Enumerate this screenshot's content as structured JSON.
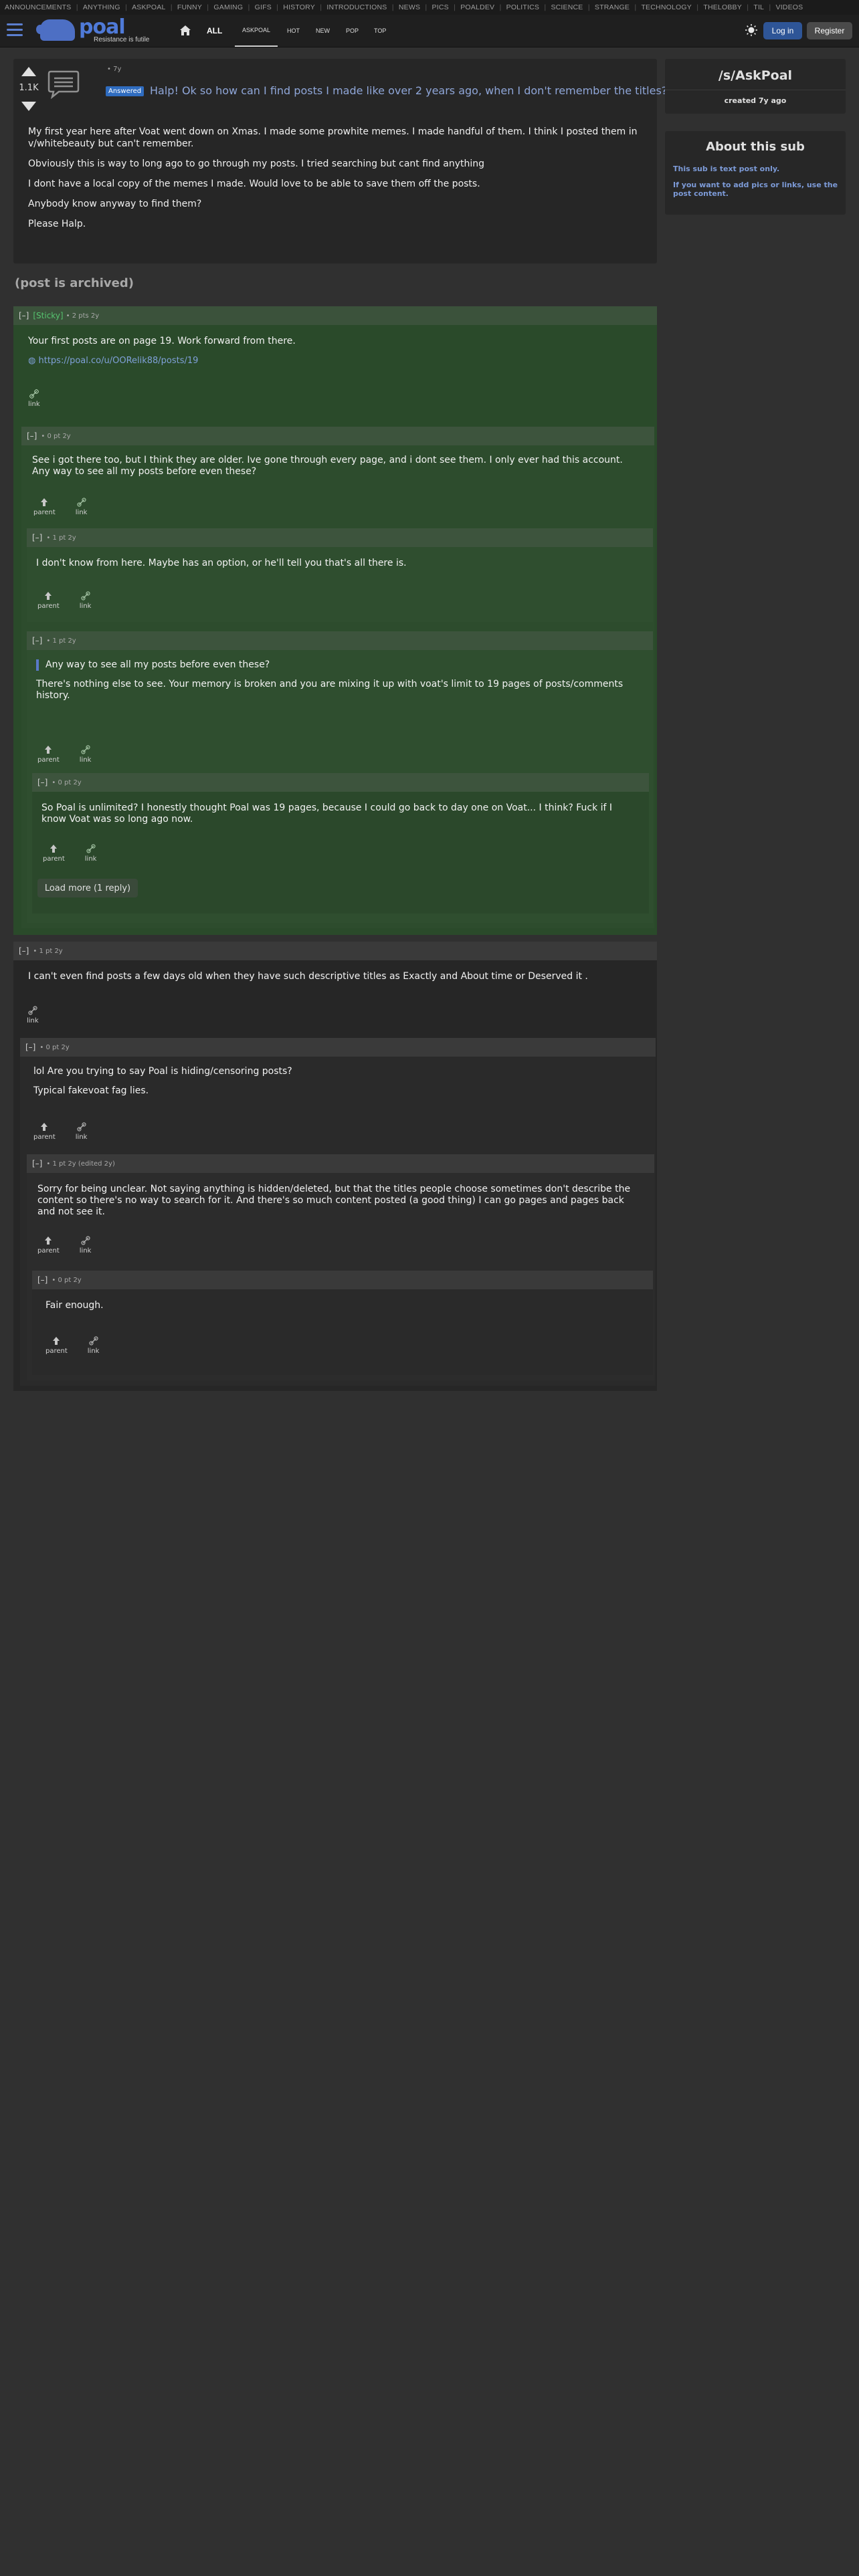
{
  "categories": [
    "ANNOUNCEMENTS",
    "ANYTHING",
    "ASKPOAL",
    "FUNNY",
    "GAMING",
    "GIFS",
    "HISTORY",
    "INTRODUCTIONS",
    "NEWS",
    "PICS",
    "POALDEV",
    "POLITICS",
    "SCIENCE",
    "STRANGE",
    "TECHNOLOGY",
    "THELOBBY",
    "TIL",
    "VIDEOS"
  ],
  "header": {
    "logo_text": "poal",
    "tagline": "Resistance is futile",
    "nav_all": "ALL",
    "nav_tabs": [
      "ASKPOAL",
      "HOT",
      "NEW",
      "POP",
      "TOP"
    ],
    "login": "Log in",
    "register": "Register"
  },
  "post": {
    "score": "1.1K",
    "meta": "• 7y",
    "flair": "Answered",
    "title": "Halp! Ok so how can I find posts I made like over 2 years ago, when I don't remember the titles?",
    "body": [
      "My first year here after Voat went down on Xmas. I made some prowhite memes. I made handful of them. I think I posted them in v/whitebeauty but can't remember.",
      "Obviously this is way to long ago to go through my posts. I tried searching but cant find anything",
      "I dont have a local copy of the memes I made. Would love to be able to save them off the posts.",
      "Anybody know anyway to find them?",
      "Please Halp."
    ],
    "archived": "(post is archived)"
  },
  "comments": {
    "c1": {
      "tog": "[–]",
      "sticky": "[Sticky]",
      "meta": "• 2 pts 2y",
      "text": "Your first posts are on page 19. Work forward from there.",
      "link": "https://poal.co/u/OORelik88/posts/19",
      "act": "link"
    },
    "c2": {
      "tog": "[–]",
      "meta": "• 0 pt 2y",
      "text": "See i got there too, but I think they are older. Ive gone through every page, and i dont see them. I only ever had this account. Any way to see all my posts before even these?",
      "parent": "parent",
      "link": "link"
    },
    "c3": {
      "tog": "[–]",
      "meta": "• 1 pt 2y",
      "text": "I don't know from here. Maybe has an option, or he'll tell you that's all there is.",
      "parent": "parent",
      "link": "link"
    },
    "c4": {
      "tog": "[–]",
      "meta": "• 1 pt 2y",
      "quote": "Any way to see all my posts before even these?",
      "text": "There's nothing else to see. Your memory is broken and you are mixing it up with voat's limit to 19 pages of posts/comments history.",
      "parent": "parent",
      "link": "link"
    },
    "c5": {
      "tog": "[–]",
      "meta": "• 0 pt 2y",
      "text": "So Poal is unlimited? I honestly thought Poal was 19 pages, because I could go back to day one on Voat... I think? Fuck if I know Voat was so long ago now.",
      "parent": "parent",
      "link": "link",
      "loadmore": "Load more (1 reply)"
    },
    "c6": {
      "tog": "[–]",
      "meta": "• 1 pt 2y",
      "text": "I can't even find posts a few days old when they have such descriptive titles as Exactly and About time or Deserved it .",
      "act": "link"
    },
    "c7": {
      "tog": "[–]",
      "meta": "• 0 pt 2y",
      "p1": "lol Are you trying to say Poal is hiding/censoring posts?",
      "p2": "Typical fakevoat fag lies.",
      "parent": "parent",
      "link": "link"
    },
    "c8": {
      "tog": "[–]",
      "meta": "• 1 pt 2y (edited 2y)",
      "text": "Sorry for being unclear. Not saying anything is hidden/deleted, but that the titles people choose sometimes don't describe the content so there's no way to search for it. And there's so much content posted (a good thing) I can go pages and pages back and not see it.",
      "parent": "parent",
      "link": "link"
    },
    "c9": {
      "tog": "[–]",
      "meta": "• 0 pt 2y",
      "text": "Fair enough.",
      "parent": "parent",
      "link": "link"
    }
  },
  "sidebar": {
    "sub": "/s/AskPoal",
    "created": "created 7y ago",
    "about": "About this sub",
    "p1": "This sub is text post only.",
    "p2": "If you want to add pics or links, use the post content."
  },
  "colors": {
    "green": "#2b4f2b",
    "green_head": "#3b523b",
    "dark": "#262626",
    "head": "#3a3a3a",
    "accent": "#2e5597"
  }
}
